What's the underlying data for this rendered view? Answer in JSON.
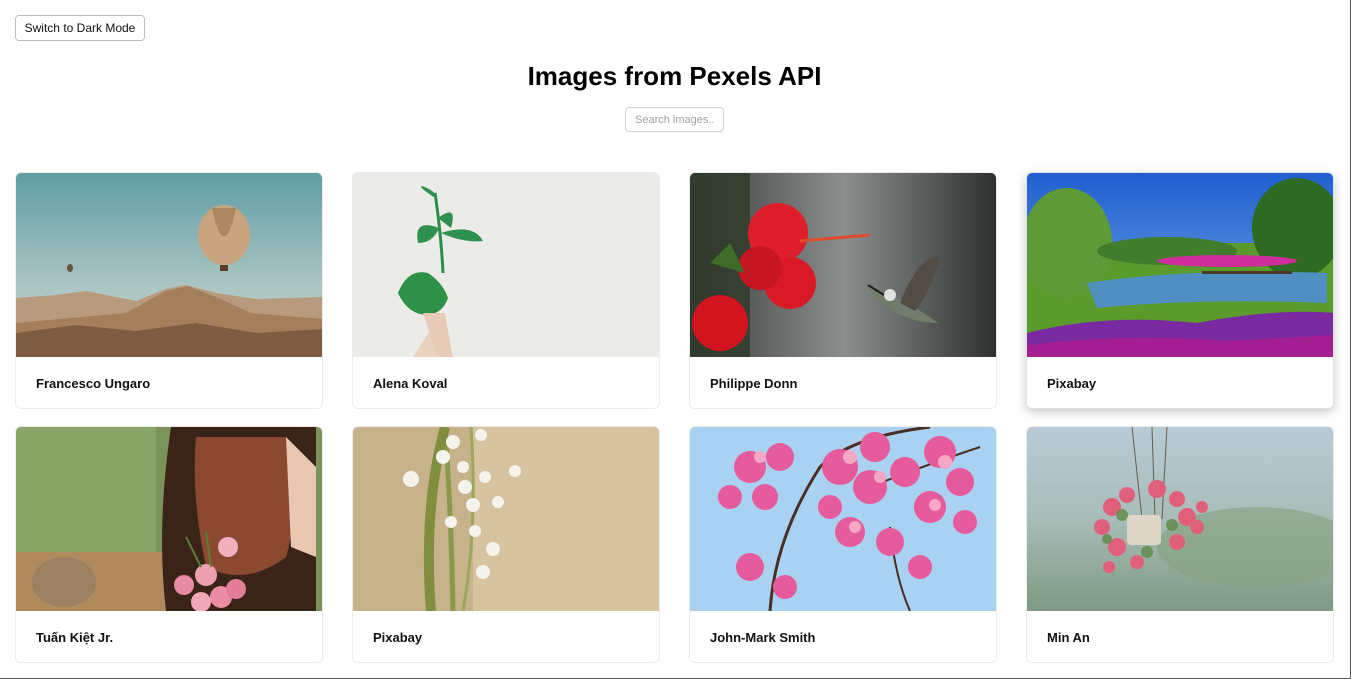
{
  "header": {
    "theme_toggle_label": "Switch to Dark Mode",
    "title": "Images from Pexels API"
  },
  "search": {
    "placeholder": "Search images...",
    "value": ""
  },
  "photos": [
    {
      "photographer": "Francesco Ungaro",
      "icon": "hot-air-balloon-photo"
    },
    {
      "photographer": "Alena Koval",
      "icon": "green-plant-hand-photo"
    },
    {
      "photographer": "Philippe Donn",
      "icon": "hummingbird-hibiscus-photo"
    },
    {
      "photographer": "Pixabay",
      "icon": "garden-landscape-photo"
    },
    {
      "photographer": "Tuấn Kiệt Jr.",
      "icon": "woman-tulips-photo"
    },
    {
      "photographer": "Pixabay",
      "icon": "lily-of-the-valley-photo"
    },
    {
      "photographer": "John-Mark Smith",
      "icon": "cherry-blossom-photo"
    },
    {
      "photographer": "Min An",
      "icon": "hanging-flower-pot-photo"
    }
  ]
}
